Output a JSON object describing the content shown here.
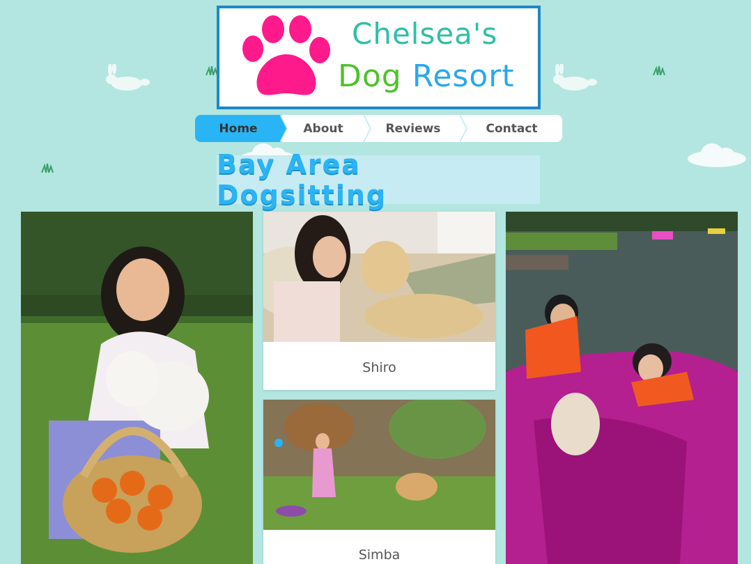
{
  "logo": {
    "line1": "Chelsea's",
    "line2_word1": "Dog",
    "line2_word2": "Resort"
  },
  "nav": {
    "items": [
      {
        "label": "Home",
        "active": true
      },
      {
        "label": "About",
        "active": false
      },
      {
        "label": "Reviews",
        "active": false
      },
      {
        "label": "Contact",
        "active": false
      }
    ]
  },
  "banner": {
    "title": "Bay Area Dogsitting"
  },
  "gallery": {
    "cards": [
      {
        "caption": "Shiro"
      },
      {
        "caption": "Simba"
      }
    ]
  },
  "colors": {
    "background": "#b3e6e0",
    "logo_border": "#1f87c8",
    "paw": "#ff1a8c",
    "nav_active": "#29b4f5",
    "banner_text": "#29b4f5"
  },
  "icons": {
    "logo": "paw-icon",
    "decor": [
      "bunny-icon",
      "grass-icon",
      "cloud-icon"
    ]
  }
}
